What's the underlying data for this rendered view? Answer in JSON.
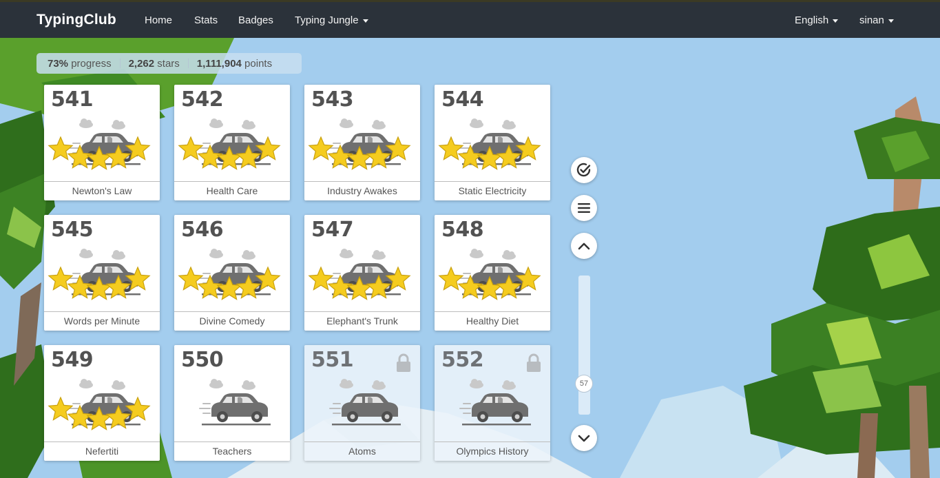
{
  "navbar": {
    "brand": "TypingClub",
    "links": [
      "Home",
      "Stats",
      "Badges"
    ],
    "dropdown": "Typing Jungle",
    "language": "English",
    "user": "sinan"
  },
  "progress": {
    "percent": "73%",
    "percent_label": "progress",
    "stars": "2,262",
    "stars_label": "stars",
    "points": "1,111,904",
    "points_label": "points"
  },
  "lessons": [
    {
      "number": "541",
      "title": "Newton's Law",
      "stars": 5,
      "locked": false
    },
    {
      "number": "542",
      "title": "Health Care",
      "stars": 5,
      "locked": false
    },
    {
      "number": "543",
      "title": "Industry Awakes",
      "stars": 5,
      "locked": false
    },
    {
      "number": "544",
      "title": "Static Electricity",
      "stars": 5,
      "locked": false
    },
    {
      "number": "545",
      "title": "Words per Minute",
      "stars": 5,
      "locked": false
    },
    {
      "number": "546",
      "title": "Divine Comedy",
      "stars": 5,
      "locked": false
    },
    {
      "number": "547",
      "title": "Elephant's Trunk",
      "stars": 5,
      "locked": false
    },
    {
      "number": "548",
      "title": "Healthy Diet",
      "stars": 5,
      "locked": false
    },
    {
      "number": "549",
      "title": "Nefertiti",
      "stars": 5,
      "locked": false
    },
    {
      "number": "550",
      "title": "Teachers",
      "stars": 0,
      "locked": false
    },
    {
      "number": "551",
      "title": "Atoms",
      "stars": 0,
      "locked": true
    },
    {
      "number": "552",
      "title": "Olympics History",
      "stars": 0,
      "locked": true
    }
  ],
  "scroll": {
    "position_label": "57"
  },
  "colors": {
    "navbar": "#2b323a",
    "star": "#f5cc1f",
    "car": "#6f6f6f",
    "sky": "#a3cdee"
  },
  "icons": {
    "progress": "check-circle-icon",
    "menu": "list-icon",
    "up": "chevron-up-icon",
    "down": "chevron-down-icon",
    "lock": "lock-icon"
  }
}
